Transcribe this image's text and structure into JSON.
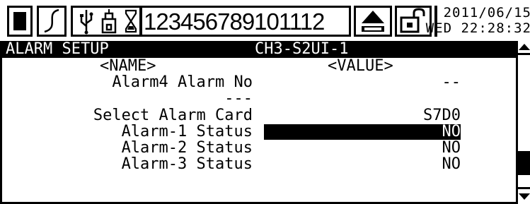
{
  "toolbar": {
    "stop_icon": "stop-square-icon",
    "trend_icon": "trend-curve-icon",
    "usb_icon": "usb-icon",
    "memory_icon": "memory-card-icon",
    "hourglass_icon": "hourglass-icon",
    "channels": "123456789101112",
    "eject_icon": "eject-icon",
    "lock_icon": "unlock-icon"
  },
  "clock": {
    "date": "2011/06/15",
    "time": "WED 22:28:32"
  },
  "titlebar": {
    "screen": "ALARM SETUP",
    "channel": "CH3-S2UI-1"
  },
  "list": {
    "header_name": "<NAME>",
    "header_value": "<VALUE>",
    "rows": [
      {
        "label": "Alarm4 Alarm No",
        "value": "--"
      },
      {
        "label": "---",
        "value": ""
      },
      {
        "label": "Select Alarm Card",
        "value": "S7D0"
      },
      {
        "label": "Alarm-1 Status",
        "value": "NO"
      },
      {
        "label": "Alarm-2 Status",
        "value": "NO"
      },
      {
        "label": "Alarm-3 Status",
        "value": "NO"
      }
    ],
    "selected_index": 3
  },
  "scrollbar": {
    "up_icon": "scroll-up-arrow-icon",
    "down_icon": "scroll-down-arrow-icon",
    "position": 0.78
  },
  "colors": {
    "foreground": "#000000",
    "background": "#ffffff"
  }
}
